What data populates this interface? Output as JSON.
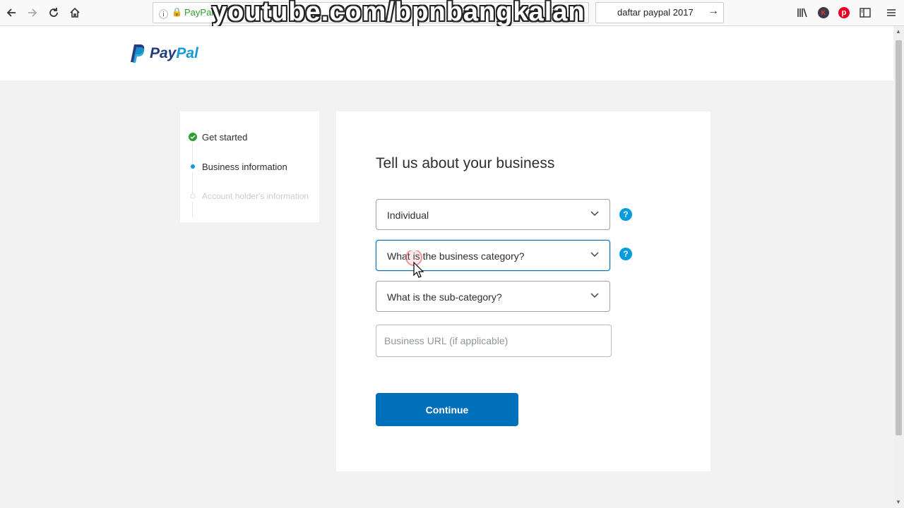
{
  "browser": {
    "url_text": "PayPal, I",
    "search_text": "daftar paypal 2017",
    "watermark": "youtube.com/bpnbangkalan",
    "icons": [
      "back-icon",
      "forward-icon",
      "reload-icon",
      "home-icon",
      "info-icon",
      "lock-icon",
      "library-icon",
      "extension-k-icon",
      "pinterest-icon",
      "sidebar-icon",
      "menu-icon"
    ]
  },
  "header": {
    "logo_part1": "Pay",
    "logo_part2": "Pal"
  },
  "steps": [
    {
      "label": "Get started",
      "state": "done"
    },
    {
      "label": "Business information",
      "state": "current"
    },
    {
      "label": "Account holder's information",
      "state": "upcoming"
    }
  ],
  "form": {
    "heading": "Tell us about your business",
    "business_type": "Individual",
    "business_category": "What is the business category?",
    "sub_category": "What is the sub-category?",
    "url_placeholder": "Business URL (if applicable)",
    "help_glyph": "?",
    "continue_label": "Continue"
  },
  "colors": {
    "primary": "#0070ba",
    "accent": "#009cde",
    "step_done": "#2e9e2e"
  }
}
